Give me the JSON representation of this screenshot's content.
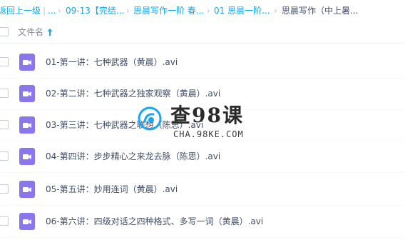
{
  "breadcrumb": {
    "back": "返回上一级",
    "ellipsis": "...",
    "sep": "›",
    "crumb1": "09-13【完结...",
    "crumb2": "思晨写作一阶 春...",
    "crumb3": "01 思晨一阶...",
    "current": "思晨写作（中上暑..."
  },
  "header": {
    "name_label": "文件名"
  },
  "files": [
    {
      "name": "01-第一讲：七种武器（黄晨）.avi"
    },
    {
      "name": "02-第二讲：七种武器之独家观察（黄晨）.avi"
    },
    {
      "name": "03-第三讲：七种武器之联想（陈思）.avi"
    },
    {
      "name": "04-第四讲：步步精心之来龙去脉（陈思）.avi"
    },
    {
      "name": "05-第五讲：妙用连词（黄晨）.avi"
    },
    {
      "name": "06-第六讲：四级对话之四种格式、多写一词（黄晨）.avi"
    }
  ],
  "watermark": {
    "title": "查98课",
    "subtitle": "CHA.98KE.COM"
  },
  "colors": {
    "link": "#09aaff",
    "video_icon": "#8c76ee",
    "text": "#424e67"
  },
  "icons": {
    "file": "video-file-icon",
    "sort": "sort-up-arrow-icon",
    "logo": "watermark-logo-icon"
  }
}
